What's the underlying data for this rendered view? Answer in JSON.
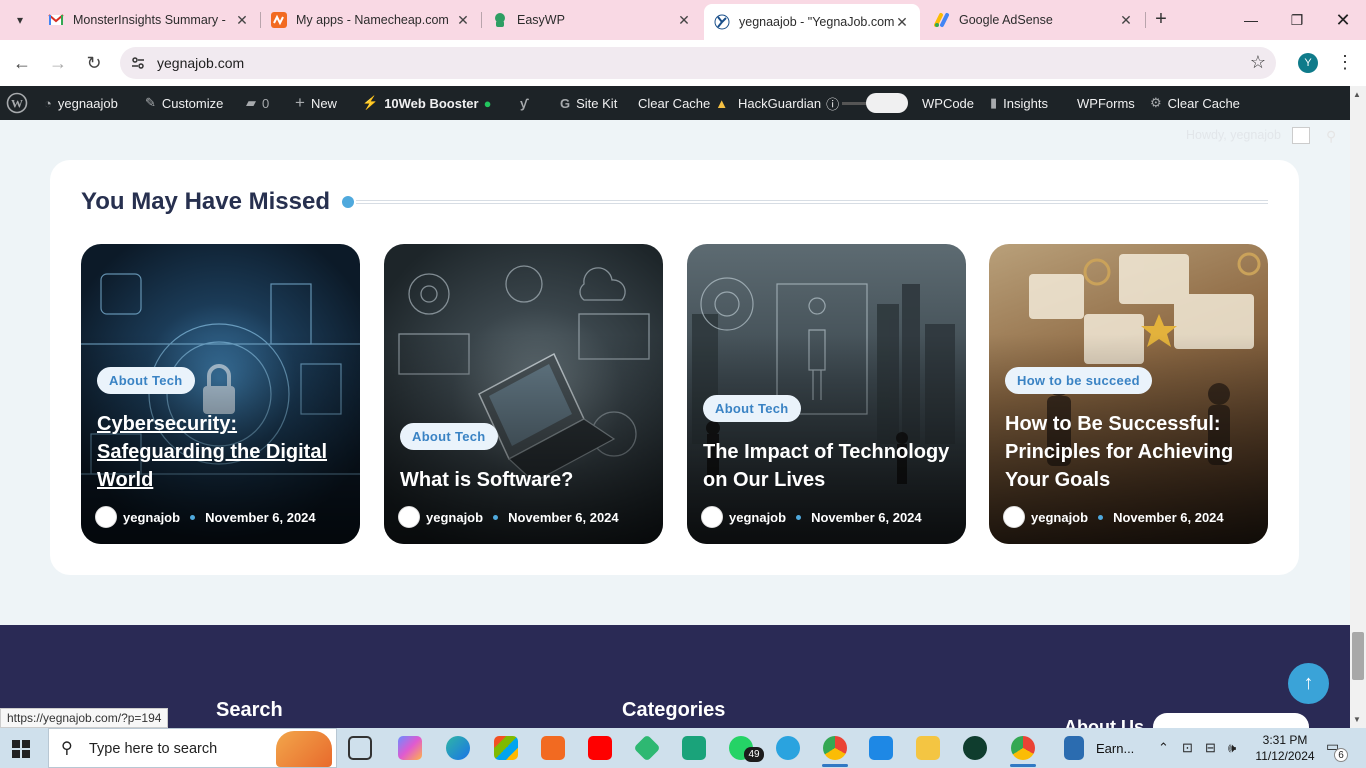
{
  "browser": {
    "tabs": [
      {
        "label": "MonsterInsights Summary -",
        "icon": "gmail-icon",
        "active": false
      },
      {
        "label": "My apps - Namecheap.com",
        "icon": "namecheap-icon",
        "active": false
      },
      {
        "label": "EasyWP",
        "icon": "easywp-icon",
        "active": false
      },
      {
        "label": "yegnaajob - \"YegnaJob.com\"",
        "icon": "yegnajob-icon",
        "active": true
      },
      {
        "label": "Google AdSense",
        "icon": "adsense-icon",
        "active": false
      }
    ],
    "url": "yegnajob.com",
    "profile_initial": "Y",
    "status_url": "https://yegnajob.com/?p=194"
  },
  "adminbar": {
    "site_name": "yegnaajob",
    "customize": "Customize",
    "comments_count": "0",
    "new": "New",
    "booster": "10Web Booster",
    "site_kit": "Site Kit",
    "clear_cache_1": "Clear Cache",
    "hackguardian": "HackGuardian",
    "wpcode": "WPCode",
    "insights": "Insights",
    "wpforms": "WPForms",
    "clear_cache_2": "Clear Cache",
    "howdy": "Howdy, yegnajob"
  },
  "section": {
    "title": "You May Have Missed"
  },
  "posts": [
    {
      "category": "About Tech",
      "title": "Cybersecurity: Safeguarding the Digital World",
      "author": "yegnajob",
      "date": "November 6, 2024"
    },
    {
      "category": "About Tech",
      "title": "What is Software?",
      "author": "yegnajob",
      "date": "November 6, 2024"
    },
    {
      "category": "About Tech",
      "title": "The Impact of Technology on Our Lives",
      "author": "yegnajob",
      "date": "November 6, 2024"
    },
    {
      "category": "How to be succeed",
      "title": "How to Be Successful: Principles for Achieving Your Goals",
      "author": "yegnajob",
      "date": "November 6, 2024"
    }
  ],
  "footer": {
    "search": "Search",
    "categories": "Categories",
    "about": "About Us"
  },
  "taskbar": {
    "search_placeholder": "Type here to search",
    "whatsapp_badge": "49",
    "earn_label": "Earn...",
    "time": "3:31 PM",
    "date": "11/12/2024",
    "notifications": "6"
  },
  "colors": {
    "accent": "#4fa9dd",
    "adminbar": "#1d2327",
    "footer": "#2a2a55",
    "tabstrip": "#f9d9e4"
  }
}
